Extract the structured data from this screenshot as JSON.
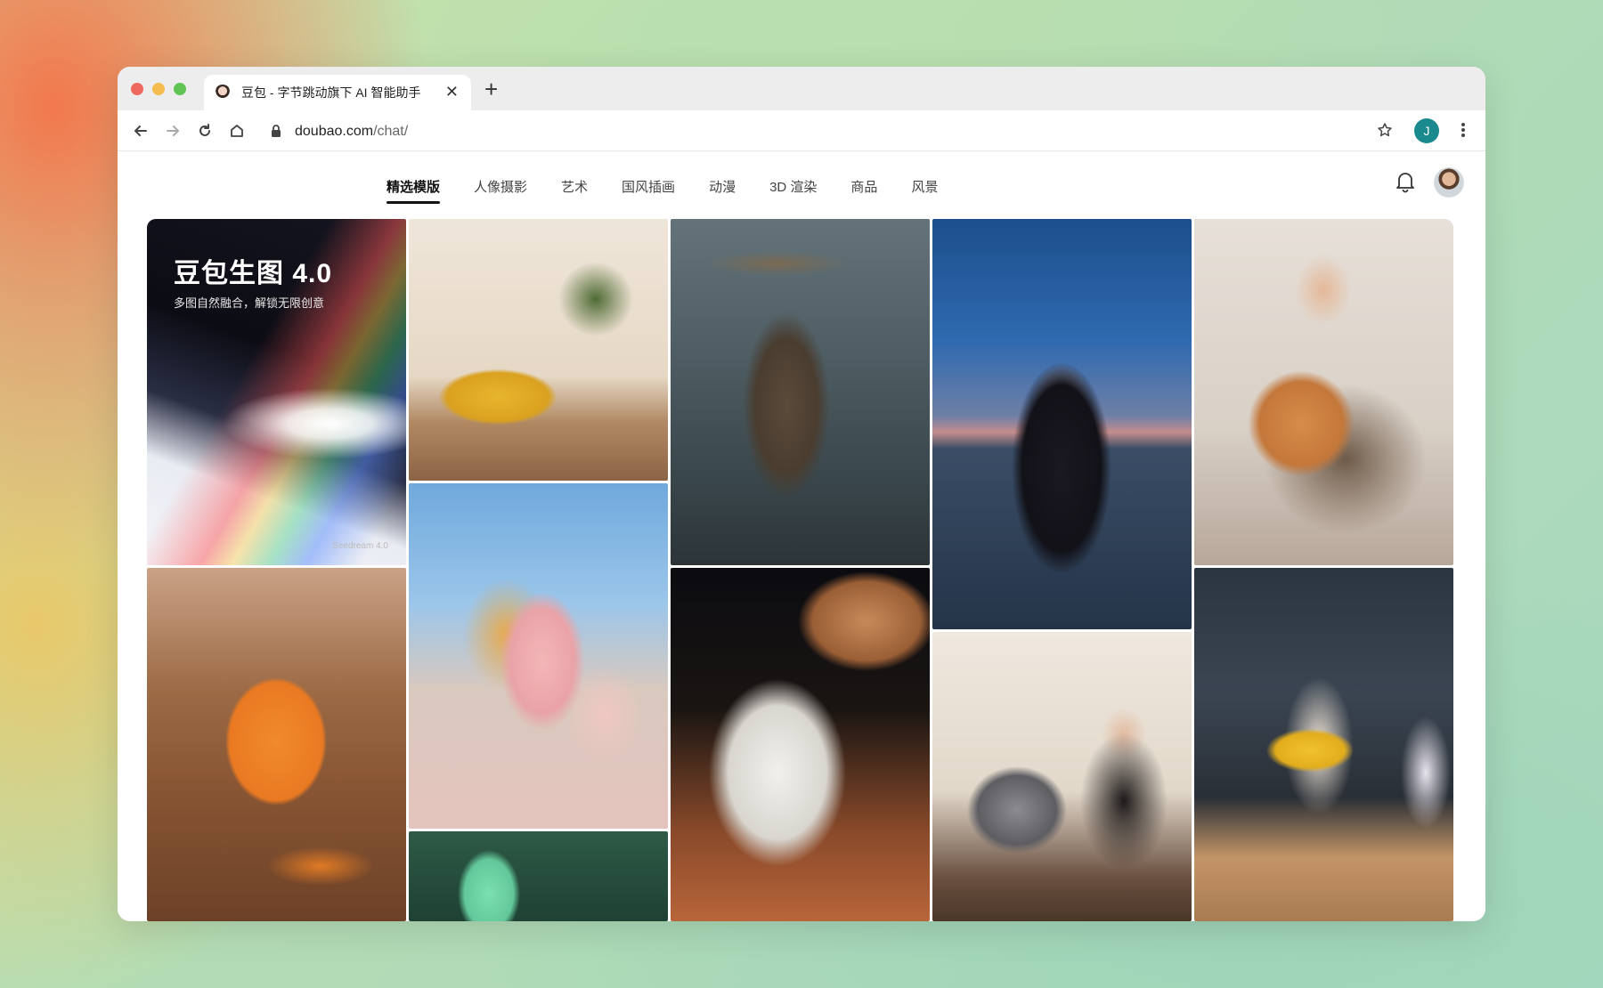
{
  "browser": {
    "tab_title": "豆包 - 字节跳动旗下 AI 智能助手",
    "url_host": "doubao.com",
    "url_path": "/chat/",
    "profile_initial": "J"
  },
  "nav": {
    "categories": [
      "精选模版",
      "人像摄影",
      "艺术",
      "国风插画",
      "动漫",
      "3D 渲染",
      "商品",
      "风景"
    ],
    "active_index": 0
  },
  "hero": {
    "title": "豆包生图 4.0",
    "subtitle": "多图自然融合，解锁无限创意",
    "brand": "Seedream 4.0"
  },
  "icons": {
    "back": "arrow-left-icon",
    "forward": "arrow-right-icon",
    "reload": "reload-icon",
    "home": "home-icon",
    "lock": "lock-icon",
    "bookmark": "star-icon",
    "menu": "kebab-menu-icon",
    "notifications": "bell-icon"
  },
  "gallery": [
    {
      "name": "gallery-tile-seedream-banner"
    },
    {
      "name": "gallery-tile-living-room-cat"
    },
    {
      "name": "gallery-tile-bamboo-swordsman"
    },
    {
      "name": "gallery-tile-woman-seagulls"
    },
    {
      "name": "gallery-tile-man-with-cat"
    },
    {
      "name": "gallery-tile-clay-cat"
    },
    {
      "name": "gallery-tile-pastel-stairs"
    },
    {
      "name": "gallery-tile-astronaut"
    },
    {
      "name": "gallery-tile-woman-with-dog"
    },
    {
      "name": "gallery-tile-figure-render"
    },
    {
      "name": "gallery-tile-green-door"
    }
  ]
}
